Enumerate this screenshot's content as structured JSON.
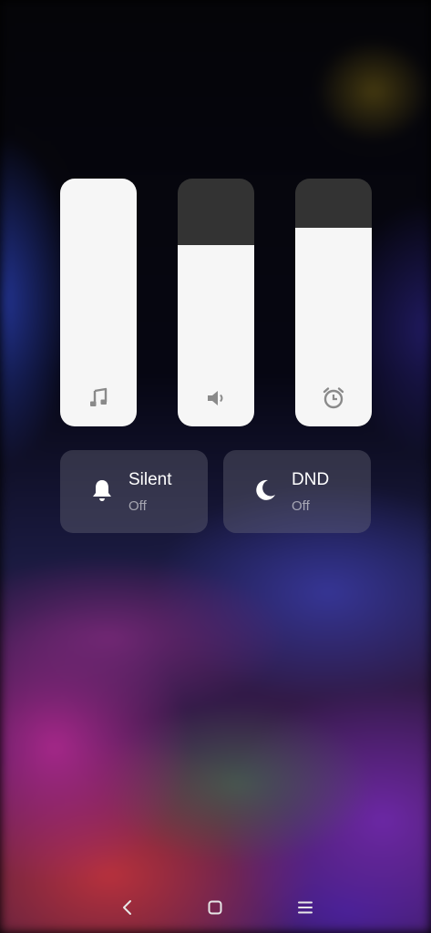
{
  "volume_panel": {
    "sliders": [
      {
        "name": "music",
        "icon": "music-note-icon",
        "level_percent": 100
      },
      {
        "name": "media",
        "icon": "speaker-icon",
        "level_percent": 73
      },
      {
        "name": "alarm",
        "icon": "alarm-clock-icon",
        "level_percent": 80
      }
    ],
    "tiles": [
      {
        "title": "Silent",
        "status": "Off",
        "icon": "bell-icon"
      },
      {
        "title": "DND",
        "status": "Off",
        "icon": "moon-icon"
      }
    ]
  },
  "navigation_bar": {
    "buttons": [
      "back-icon",
      "home-icon",
      "menu-icon"
    ]
  },
  "colors": {
    "slider_fill": "#f6f6f6",
    "slider_track": "#333333",
    "tile_background": "rgba(110,110,125,0.38)",
    "slider_icon": "#8a8a8a"
  }
}
